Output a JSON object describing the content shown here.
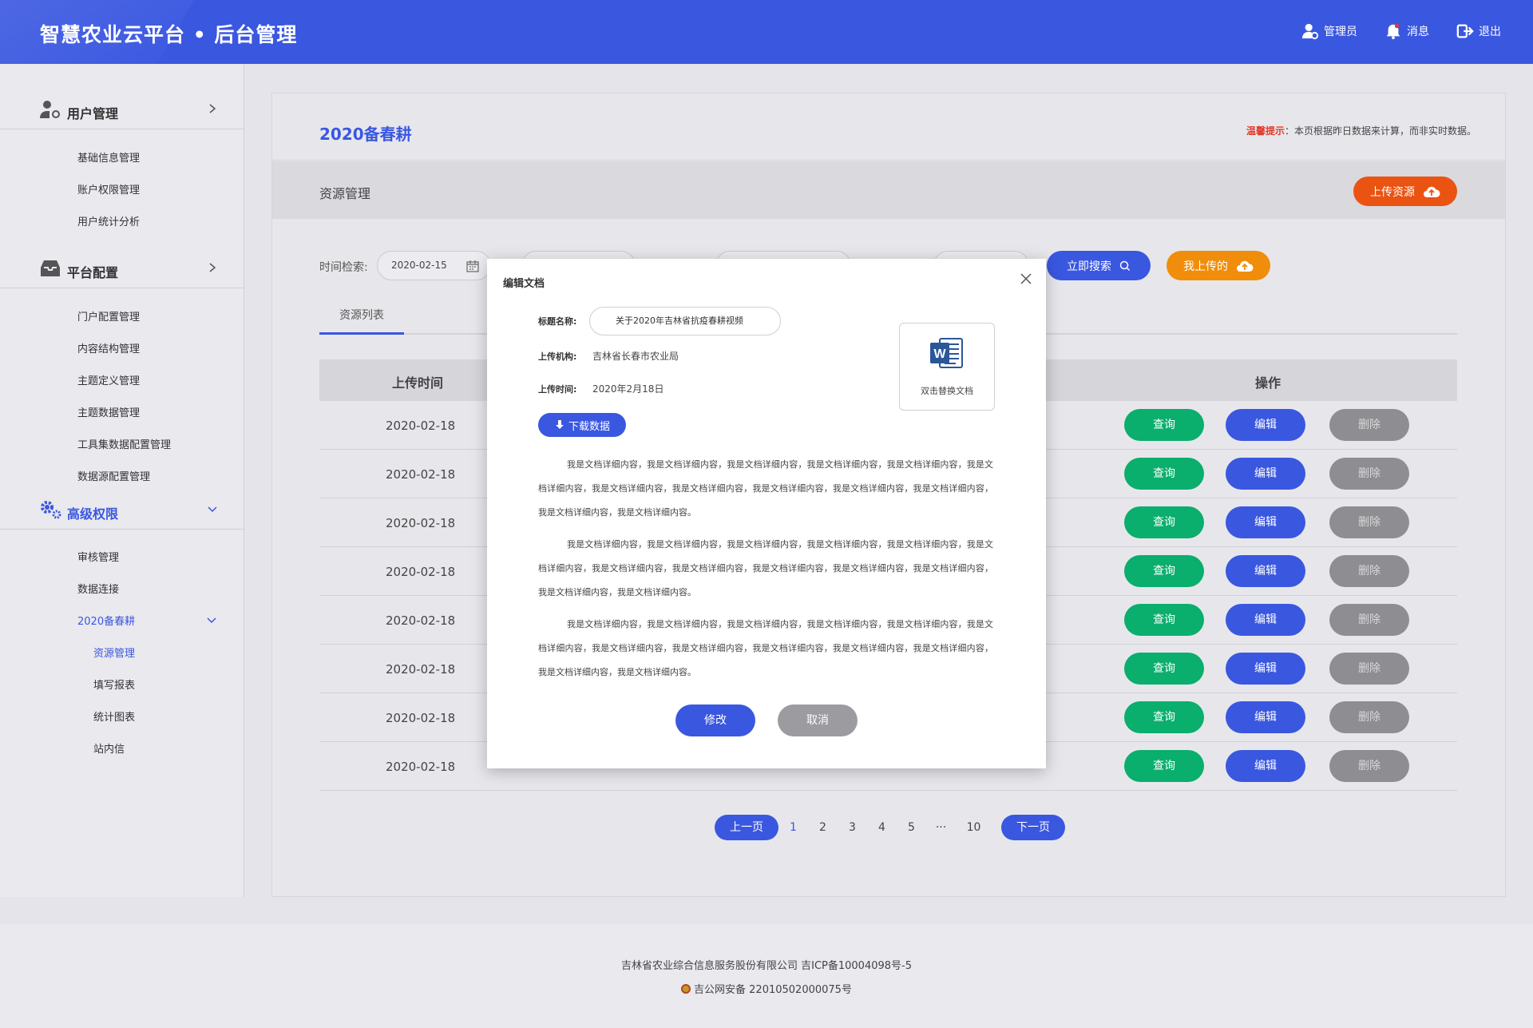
{
  "header": {
    "title": "智慧农业云平台 • 后台管理",
    "admin": "管理员",
    "messages": "消息",
    "logout": "退出"
  },
  "sidebar": {
    "sections": [
      {
        "label": "用户管理",
        "items": [
          "基础信息管理",
          "账户权限管理",
          "用户统计分析"
        ]
      },
      {
        "label": "平台配置",
        "items": [
          "门户配置管理",
          "内容结构管理",
          "主题定义管理",
          "主题数据管理",
          "工具集数据配置管理",
          "数据源配置管理"
        ]
      },
      {
        "label": "高级权限",
        "items": [
          "审核管理",
          "数据连接",
          "2020备春耕"
        ],
        "sub_items": [
          "资源管理",
          "填写报表",
          "统计图表",
          "站内信"
        ]
      }
    ]
  },
  "page": {
    "title": "2020备春耕",
    "tip_label": "温馨提示",
    "tip_colon": "：",
    "tip_text": "本页根据昨日数据来计算，而非实时数据。",
    "section_title": "资源管理",
    "upload_button": "上传资源"
  },
  "search": {
    "label": "时间检索:",
    "date_value": "2020-02-15",
    "search_button": "立即搜索",
    "mine_button": "我上传的"
  },
  "tabs": [
    "资源列表"
  ],
  "table": {
    "headers": {
      "time": "上传时间",
      "actions": "操作"
    },
    "rows": [
      {
        "time": "2020-02-18"
      },
      {
        "time": "2020-02-18"
      },
      {
        "time": "2020-02-18"
      },
      {
        "time": "2020-02-18"
      },
      {
        "time": "2020-02-18"
      },
      {
        "time": "2020-02-18"
      },
      {
        "time": "2020-02-18"
      },
      {
        "time": "2020-02-18"
      }
    ],
    "btn_query": "查询",
    "btn_edit": "编辑",
    "btn_delete": "删除"
  },
  "pagination": {
    "prev": "上一页",
    "next": "下一页",
    "pages": [
      "1",
      "2",
      "3",
      "4",
      "5",
      "···",
      "10"
    ],
    "current": "1"
  },
  "modal": {
    "title": "编辑文档",
    "title_label": "标题名称:",
    "title_value": "关于2020年吉林省抗疫春耕视频",
    "org_label": "上传机构:",
    "org_value": "吉林省长春市农业局",
    "time_label": "上传时间:",
    "time_value": "2020年2月18日",
    "replace_doc": "双击替换文档",
    "download": "下载数据",
    "paragraphs": [
      "我是文档详细内容，我是文档详细内容，我是文档详细内容，我是文档详细内容，我是文档详细内容，我是文档详细内容，我是文档详细内容，我是文档详细内容，我是文档详细内容，我是文档详细内容，我是文档详细内容，我是文档详细内容，我是文档详细内容。",
      "我是文档详细内容，我是文档详细内容，我是文档详细内容，我是文档详细内容，我是文档详细内容，我是文档详细内容，我是文档详细内容，我是文档详细内容，我是文档详细内容，我是文档详细内容，我是文档详细内容，我是文档详细内容，我是文档详细内容。",
      "我是文档详细内容，我是文档详细内容，我是文档详细内容，我是文档详细内容，我是文档详细内容，我是文档详细内容，我是文档详细内容，我是文档详细内容，我是文档详细内容，我是文档详细内容，我是文档详细内容，我是文档详细内容，我是文档详细内容。"
    ],
    "confirm": "修改",
    "cancel": "取消"
  },
  "footer": {
    "line1": "吉林省农业综合信息服务股份有限公司   吉ICP备10004098号-5",
    "line2": "吉公网安备 22010502000075号"
  },
  "colors": {
    "primary": "#3a57e0",
    "upload": "#ea5312",
    "mine": "#f08d0a",
    "query": "#0aae6d",
    "delete": "#8e8e92"
  }
}
